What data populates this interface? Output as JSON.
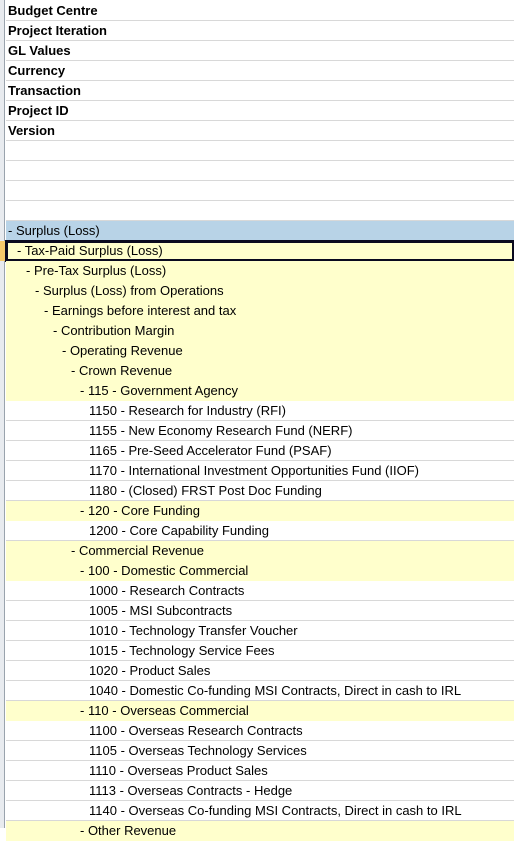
{
  "parameters": [
    {
      "label": "Budget Centre"
    },
    {
      "label": "Project Iteration"
    },
    {
      "label": "GL Values"
    },
    {
      "label": "Currency"
    },
    {
      "label": "Transaction"
    },
    {
      "label": "Project ID"
    },
    {
      "label": "Version"
    }
  ],
  "empty_rows": 4,
  "tree": [
    {
      "label": "- Surplus (Loss)",
      "level": 0,
      "style": "blue"
    },
    {
      "label": "- Tax-Paid Surplus (Loss)",
      "level": 1,
      "style": "yellow",
      "selected": true
    },
    {
      "label": "- Pre-Tax Surplus (Loss)",
      "level": 2,
      "style": "yellow"
    },
    {
      "label": "- Surplus (Loss) from Operations",
      "level": 3,
      "style": "yellow"
    },
    {
      "label": "- Earnings before interest and tax",
      "level": 4,
      "style": "yellow"
    },
    {
      "label": "- Contribution Margin",
      "level": 5,
      "style": "yellow"
    },
    {
      "label": "- Operating Revenue",
      "level": 6,
      "style": "yellow"
    },
    {
      "label": "- Crown Revenue",
      "level": 7,
      "style": "yellow"
    },
    {
      "label": "- 115 - Government Agency",
      "level": 8,
      "style": "yellow"
    },
    {
      "label": "1150 - Research for Industry (RFI)",
      "level": 9,
      "style": "white"
    },
    {
      "label": "1155 - New Economy Research Fund (NERF)",
      "level": 9,
      "style": "white"
    },
    {
      "label": "1165 - Pre-Seed Accelerator Fund (PSAF)",
      "level": 9,
      "style": "white"
    },
    {
      "label": "1170 - International Investment Opportunities Fund (IIOF)",
      "level": 9,
      "style": "white"
    },
    {
      "label": "1180 - (Closed) FRST Post Doc Funding",
      "level": 9,
      "style": "white"
    },
    {
      "label": "- 120 - Core Funding",
      "level": 8,
      "style": "yellow"
    },
    {
      "label": "1200 - Core Capability Funding",
      "level": 9,
      "style": "white"
    },
    {
      "label": "- Commercial Revenue",
      "level": 7,
      "style": "yellow"
    },
    {
      "label": "- 100 - Domestic Commercial",
      "level": 8,
      "style": "yellow"
    },
    {
      "label": "1000 - Research Contracts",
      "level": 9,
      "style": "white"
    },
    {
      "label": "1005 - MSI Subcontracts",
      "level": 9,
      "style": "white"
    },
    {
      "label": "1010 - Technology Transfer Voucher",
      "level": 9,
      "style": "white"
    },
    {
      "label": "1015 - Technology Service Fees",
      "level": 9,
      "style": "white"
    },
    {
      "label": "1020 - Product Sales",
      "level": 9,
      "style": "white"
    },
    {
      "label": "1040 - Domestic Co-funding MSI Contracts, Direct in cash to IRL",
      "level": 9,
      "style": "white"
    },
    {
      "label": "- 110 - Overseas Commercial",
      "level": 8,
      "style": "yellow"
    },
    {
      "label": "1100 - Overseas Research Contracts",
      "level": 9,
      "style": "white"
    },
    {
      "label": "1105 - Overseas Technology Services",
      "level": 9,
      "style": "white"
    },
    {
      "label": "1110 - Overseas Product Sales",
      "level": 9,
      "style": "white"
    },
    {
      "label": "1113 - Overseas Contracts - Hedge",
      "level": 9,
      "style": "white"
    },
    {
      "label": "1140 - Overseas Co-funding MSI Contracts, Direct in cash to IRL",
      "level": 9,
      "style": "white"
    },
    {
      "label": "- Other Revenue",
      "level": 8,
      "style": "yellow"
    }
  ]
}
